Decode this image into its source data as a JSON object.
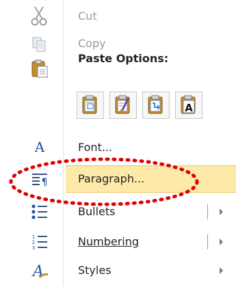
{
  "menu": {
    "cut_label": "Cut",
    "copy_label": "Copy",
    "paste_options_heading": "Paste Options:",
    "paste_buttons": [
      "keep-source-formatting-icon",
      "merge-formatting-icon",
      "link-paste-icon",
      "keep-text-only-icon"
    ],
    "paste_text_only_glyph": "A",
    "font_label": "Font...",
    "paragraph_label": "Paragraph...",
    "bullets_label": "Bullets",
    "numbering_label": "Numbering",
    "styles_label": "Styles"
  },
  "colors": {
    "highlight": "#fde9a8",
    "callout": "#e00000",
    "disabled_text": "#9a9a9a"
  }
}
